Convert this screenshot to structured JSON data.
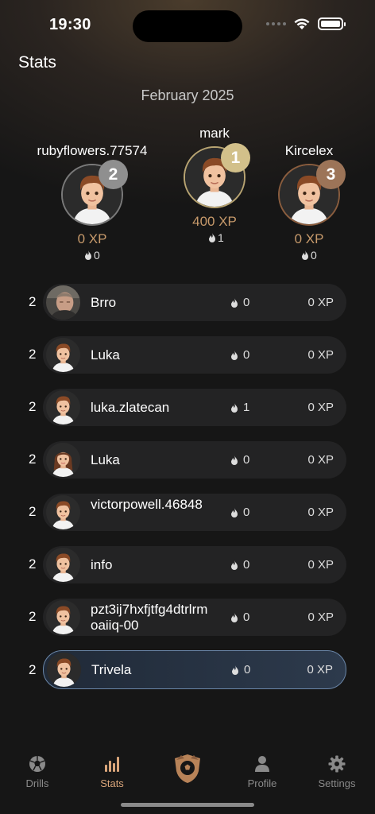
{
  "status_bar": {
    "time": "19:30"
  },
  "header": {
    "title": "Stats",
    "month": "February 2025"
  },
  "podium": [
    {
      "place": "1",
      "name": "mark",
      "xp": "400 XP",
      "streak": "1",
      "badge_color": "#d2c08a",
      "ring_color": "#b8a472"
    },
    {
      "place": "2",
      "name": "rubyflowers.77574",
      "xp": "0 XP",
      "streak": "0",
      "badge_color": "#8f8f8f",
      "ring_color": "#7a7a7a"
    },
    {
      "place": "3",
      "name": "Kircelex",
      "xp": "0 XP",
      "streak": "0",
      "badge_color": "#9c7458",
      "ring_color": "#8a5d3e"
    }
  ],
  "leaderboard": [
    {
      "rank": "2",
      "name": "Brro",
      "streak": "0",
      "xp": "0 XP",
      "avatar": "photo"
    },
    {
      "rank": "2",
      "name": "Luka",
      "streak": "0",
      "xp": "0 XP",
      "avatar": "boy"
    },
    {
      "rank": "2",
      "name": "luka.zlatecan",
      "streak": "1",
      "xp": "0 XP",
      "avatar": "boy"
    },
    {
      "rank": "2",
      "name": "Luka",
      "streak": "0",
      "xp": "0 XP",
      "avatar": "girl"
    },
    {
      "rank": "2",
      "name": "victorpowell.46848",
      "streak": "0",
      "xp": "0 XP",
      "avatar": "boy"
    },
    {
      "rank": "2",
      "name": "info",
      "streak": "0",
      "xp": "0 XP",
      "avatar": "boy"
    },
    {
      "rank": "2",
      "name": "pzt3ij7hxfjtfg4dtrlrmoaiiq-00",
      "streak": "0",
      "xp": "0 XP",
      "avatar": "boy"
    },
    {
      "rank": "2",
      "name": "Trivela",
      "streak": "0",
      "xp": "0 XP",
      "avatar": "boy",
      "current_user": true
    }
  ],
  "tabbar": {
    "items": [
      {
        "label": "Drills",
        "icon": "soccer-ball-icon",
        "active": false
      },
      {
        "label": "Stats",
        "icon": "bar-chart-icon",
        "active": true
      },
      {
        "label": "",
        "icon": "shield-logo-icon",
        "active": false
      },
      {
        "label": "Profile",
        "icon": "person-icon",
        "active": false
      },
      {
        "label": "Settings",
        "icon": "gear-icon",
        "active": false
      }
    ]
  },
  "colors": {
    "accent": "#d9a57a",
    "xp": "#c79a6b",
    "row_bg": "#232324",
    "current_row_border": "#6a86a8"
  }
}
